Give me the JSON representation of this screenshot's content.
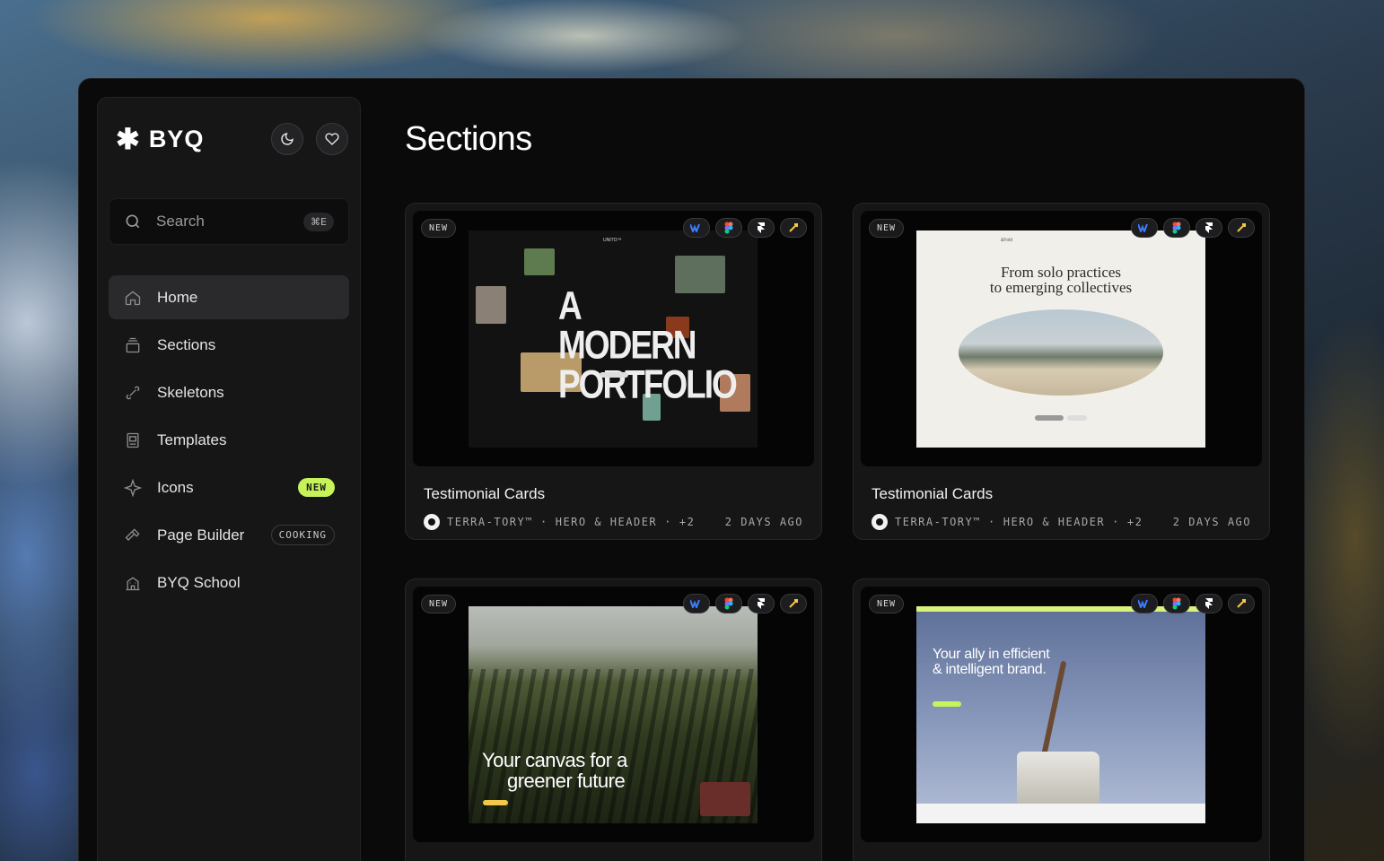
{
  "brand": {
    "name": "BYQ"
  },
  "header_buttons": [
    {
      "name": "theme-toggle",
      "icon": "moon-icon"
    },
    {
      "name": "favorites",
      "icon": "heart-icon"
    }
  ],
  "search": {
    "placeholder": "Search",
    "shortcut": "⌘E"
  },
  "nav": [
    {
      "label": "Home",
      "icon": "home-icon",
      "active": true
    },
    {
      "label": "Sections",
      "icon": "layers-icon"
    },
    {
      "label": "Skeletons",
      "icon": "bone-icon"
    },
    {
      "label": "Templates",
      "icon": "template-icon"
    },
    {
      "label": "Icons",
      "icon": "sparkle-icon",
      "badge": "NEW"
    },
    {
      "label": "Page Builder",
      "icon": "hammer-icon",
      "badge": "COOKING"
    },
    {
      "label": "BYQ School",
      "icon": "school-icon"
    }
  ],
  "page": {
    "title": "Sections"
  },
  "cards": [
    {
      "badge": "NEW",
      "title": "Testimonial Cards",
      "author": "TERRA-TORY™",
      "category": "HERO & HEADER",
      "extra": "+2",
      "time": "2 DAYS AGO",
      "thumb": {
        "headline": "A MODERN PORTFOLIO",
        "brand": "UNITO™"
      }
    },
    {
      "badge": "NEW",
      "title": "Testimonial Cards",
      "author": "TERRA-TORY™",
      "category": "HERO & HEADER",
      "extra": "+2",
      "time": "2 DAYS AGO",
      "thumb": {
        "headline_1": "From solo practices",
        "headline_2": "to emerging collectives",
        "brand": "&Fold"
      }
    },
    {
      "badge": "NEW",
      "thumb": {
        "headline_1": "Your canvas for a",
        "headline_2": "greener future"
      }
    },
    {
      "badge": "NEW",
      "thumb": {
        "headline_1": "Your ally in efficient",
        "headline_2": "& intelligent brand."
      }
    }
  ],
  "colors": {
    "accent": "#c7f35a",
    "background": "#0a0a0a",
    "sidebar": "#161617"
  }
}
